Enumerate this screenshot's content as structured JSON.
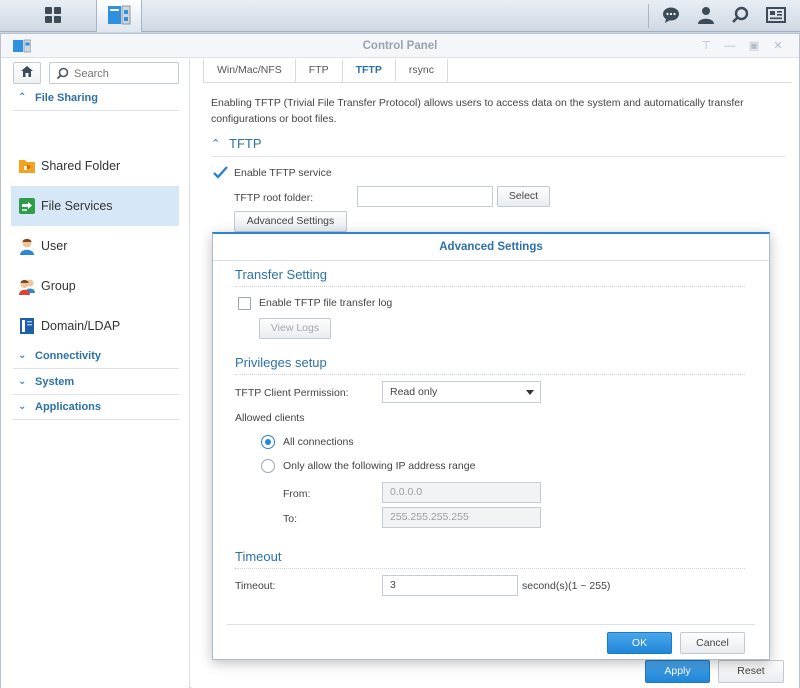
{
  "window": {
    "title": "Control Panel"
  },
  "sidebar": {
    "search_placeholder": "Search",
    "categories": {
      "file_sharing": "File Sharing",
      "connectivity": "Connectivity",
      "system": "System",
      "applications": "Applications"
    },
    "items": [
      {
        "label": "Shared Folder",
        "icon": "folder-icon"
      },
      {
        "label": "File Services",
        "icon": "file-services-icon",
        "active": true
      },
      {
        "label": "User",
        "icon": "user-icon"
      },
      {
        "label": "Group",
        "icon": "group-icon"
      },
      {
        "label": "Domain/LDAP",
        "icon": "domain-icon"
      }
    ]
  },
  "tabs": [
    "Win/Mac/NFS",
    "FTP",
    "TFTP",
    "rsync"
  ],
  "active_tab": "TFTP",
  "main": {
    "description": "Enabling TFTP (Trivial File Transfer Protocol) allows users to access data on the system and automatically transfer configurations or boot files.",
    "section_title": "TFTP",
    "enable_label": "Enable TFTP service",
    "enable_checked": true,
    "root_folder_label": "TFTP root folder:",
    "root_folder_value": "",
    "select_button": "Select",
    "advanced_button": "Advanced Settings",
    "apply_button": "Apply",
    "reset_button": "Reset"
  },
  "modal": {
    "title": "Advanced Settings",
    "transfer_section": "Transfer Setting",
    "log_label": "Enable TFTP file transfer log",
    "log_checked": false,
    "view_logs_button": "View Logs",
    "privileges_section": "Privileges setup",
    "permission_label": "TFTP Client Permission:",
    "permission_value": "Read only",
    "allowed_clients_label": "Allowed clients",
    "all_connections_label": "All connections",
    "ip_range_label": "Only allow the following IP address range",
    "from_label": "From:",
    "from_value": "0.0.0.0",
    "to_label": "To:",
    "to_value": "255.255.255.255",
    "timeout_section": "Timeout",
    "timeout_label": "Timeout:",
    "timeout_value": "3",
    "timeout_unit": "second(s)(1 ~ 255)",
    "ok_button": "OK",
    "cancel_button": "Cancel"
  },
  "colors": {
    "accent": "#2c71a8",
    "primary_button": "#1f86d8",
    "active_nav": "#d6e8f7"
  }
}
